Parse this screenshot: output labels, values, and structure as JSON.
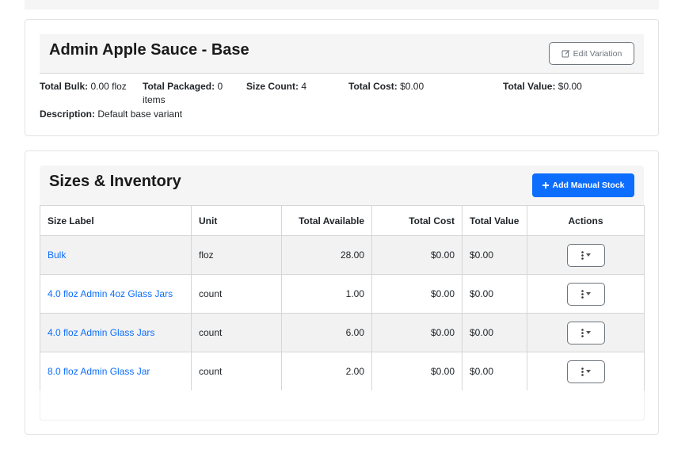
{
  "variation": {
    "title": "Admin Apple Sauce - Base",
    "edit_label": "Edit Variation",
    "stats": [
      {
        "label": "Total Bulk:",
        "value": " 0.00 floz"
      },
      {
        "label": "Total Packaged:",
        "value": " 0 items"
      },
      {
        "label": "Size Count:",
        "value": " 4"
      },
      {
        "label": "Total Cost:",
        "value": " $0.00"
      },
      {
        "label": "Total Value:",
        "value": " $0.00"
      }
    ],
    "description_label": "Description:",
    "description_value": " Default base variant"
  },
  "sizes": {
    "title": "Sizes & Inventory",
    "add_label": "Add Manual Stock",
    "headers": [
      "Size Label",
      "Unit",
      "Total Available",
      "Total Cost",
      "Total Value",
      "Actions"
    ],
    "rows": [
      {
        "label": "Bulk",
        "unit": "floz",
        "available": "28.00",
        "cost": "$0.00",
        "value": "$0.00"
      },
      {
        "label": "4.0 floz Admin 4oz Glass Jars",
        "unit": "count",
        "available": "1.00",
        "cost": "$0.00",
        "value": "$0.00"
      },
      {
        "label": "4.0 floz Admin Glass Jars",
        "unit": "count",
        "available": "6.00",
        "cost": "$0.00",
        "value": "$0.00"
      },
      {
        "label": "8.0 floz Admin Glass Jar",
        "unit": "count",
        "available": "2.00",
        "cost": "$0.00",
        "value": "$0.00"
      }
    ]
  },
  "icons": {
    "edit": "edit-icon",
    "plus": "plus-icon",
    "kebab": "kebab-icon",
    "caret": "caret-down-icon"
  },
  "colors": {
    "primary": "#0d6efd",
    "link": "#0d6efd",
    "header_bg": "#f5f5f5"
  }
}
